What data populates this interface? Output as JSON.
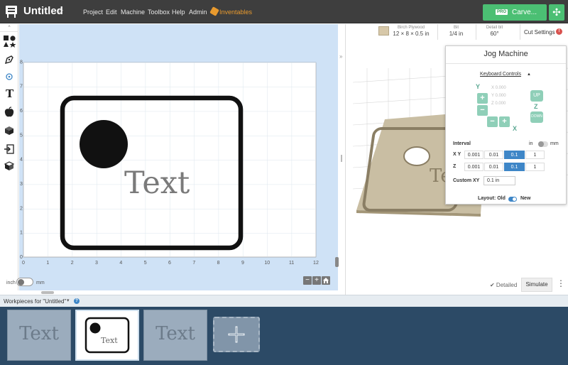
{
  "header": {
    "title": "Untitled",
    "menu": [
      "Project",
      "Edit",
      "Machine",
      "Toolbox",
      "Help",
      "Admin",
      "Inventables"
    ],
    "pro_badge": "PRO",
    "carve_label": "Carve..."
  },
  "canvas": {
    "ruler_x": [
      "0",
      "1",
      "2",
      "3",
      "4",
      "5",
      "6",
      "7",
      "8",
      "9",
      "10",
      "11",
      "12"
    ],
    "ruler_y": [
      "0",
      "1",
      "2",
      "3",
      "4",
      "5",
      "6",
      "7",
      "8"
    ],
    "design_text": "Text",
    "unit_inch": "inch",
    "unit_mm": "mm",
    "zoom_out": "−",
    "zoom_in": "+",
    "home_icon": "home-icon"
  },
  "material": {
    "name": "Birch Plywood",
    "size": "12 × 8 × 0.5 in",
    "bit_label": "Bit",
    "bit_value": "1/4 in",
    "detail_label": "Detail bit",
    "detail_value": "60°",
    "cut_settings": "Cut Settings",
    "alert": "!"
  },
  "preview": {
    "engraved_text": "Text"
  },
  "jog": {
    "title": "Jog Machine",
    "keyboard_controls": "Keyboard Controls",
    "coords": [
      "X 0.000",
      "Y 0.000",
      "Z 0.000"
    ],
    "y_label": "Y",
    "x_label": "X",
    "z_label": "Z",
    "z_up": "UP",
    "z_down": "DOWN",
    "interval_label": "Interval",
    "interval_unit_in": "in",
    "interval_unit_mm": "mm",
    "xy_label": "X Y",
    "z_row_label": "Z",
    "xy_values": [
      "0.001",
      "0.01",
      "0.1",
      "1"
    ],
    "z_values": [
      "0.001",
      "0.01",
      "0.1",
      "1"
    ],
    "selected_index": 2,
    "custom_xy_label": "Custom XY",
    "custom_xy_value": "0.1 in",
    "layout_label": "Layout: Old",
    "layout_new": "New"
  },
  "bottom_right": {
    "detailed": "✔ Detailed",
    "simulate": "Simulate",
    "more": "⋮"
  },
  "workpieces": {
    "title": "Workpieces for \"Untitled\"",
    "thumb_text": "Text"
  },
  "colors": {
    "accent": "#4bbf73",
    "selection": "#3e86c7",
    "jog_green": "#8fcfb8",
    "tray": "#2c4a66"
  }
}
